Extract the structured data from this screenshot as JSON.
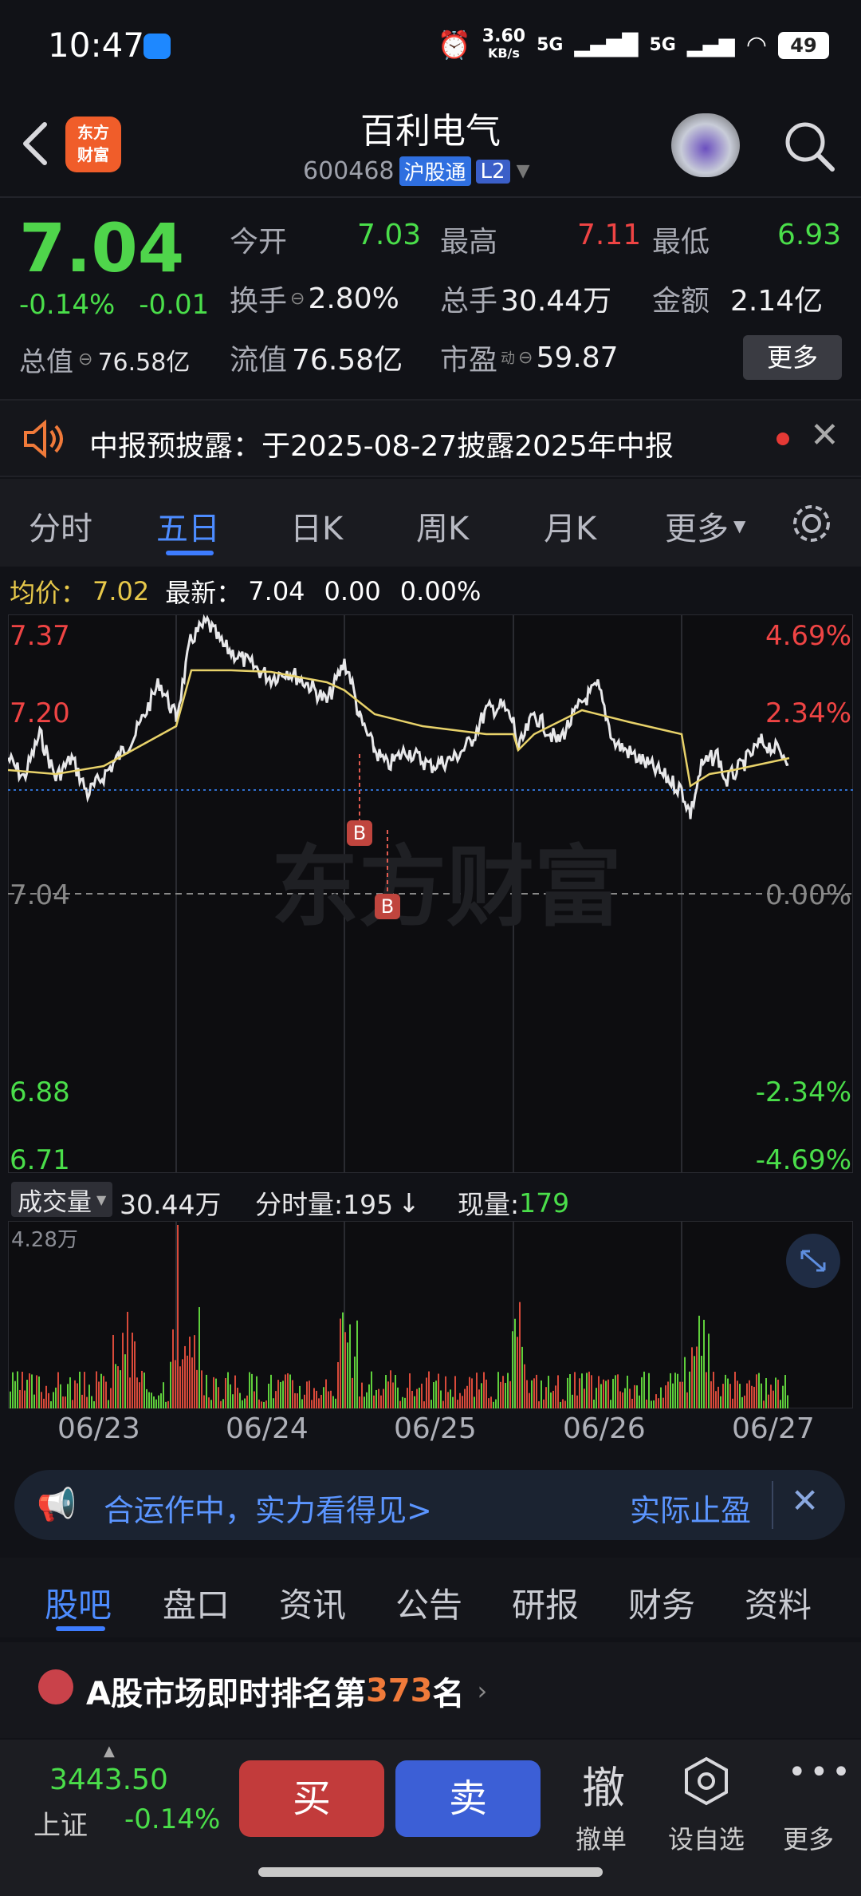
{
  "status_bar": {
    "time": "10:47",
    "net_speed_top": "3.60",
    "net_speed_unit": "KB/s",
    "sig1": "5G",
    "sig2": "5G",
    "battery": "49"
  },
  "header": {
    "title": "百利电气",
    "code": "600468",
    "tag1": "沪股通",
    "tag2": "L2",
    "logo_line1": "东方",
    "logo_line2": "财富"
  },
  "quote": {
    "price": "7.04",
    "change_pct": "-0.14%",
    "change": "-0.01",
    "open_label": "今开",
    "open": "7.03",
    "high_label": "最高",
    "high": "7.11",
    "low_label": "最低",
    "low": "6.93",
    "turnover_label": "换手",
    "turnover": "2.80%",
    "volume_label": "总手",
    "volume": "30.44万",
    "amount_label": "金额",
    "amount": "2.14亿",
    "mktcap_label": "总值",
    "mktcap": "76.58亿",
    "float_label": "流值",
    "float": "76.58亿",
    "pe_label": "市盈",
    "pe_sup": "动",
    "pe": "59.87",
    "more": "更多"
  },
  "notice": {
    "text": "中报预披露：于2025-08-27披露2025年中报"
  },
  "tabs": [
    "分时",
    "五日",
    "日K",
    "周K",
    "月K",
    "更多"
  ],
  "info_row": {
    "avg_label": "均价：",
    "avg": "7.02",
    "latest_label": "最新：",
    "latest": "7.04",
    "chg": "0.00",
    "chg_pct": "0.00%"
  },
  "chart_data": {
    "type": "line",
    "title": "",
    "x": [
      "06/23",
      "06/24",
      "06/25",
      "06/26",
      "06/27"
    ],
    "y_left_ticks": [
      "7.37",
      "7.20",
      "7.04",
      "6.88",
      "6.71"
    ],
    "y_right_ticks": [
      "4.69%",
      "2.34%",
      "0.00%",
      "-2.34%",
      "-4.69%"
    ],
    "ylim": [
      6.71,
      7.37
    ],
    "series": [],
    "markers": [
      "B",
      "B"
    ],
    "watermark": "东方财富"
  },
  "volume": {
    "label": "成交量",
    "total": "30.44万",
    "tick_label": "分时量:195",
    "tick_arrow": "↓",
    "now_label": "现量:",
    "now": "179",
    "max": "4.28万"
  },
  "ad": {
    "text": "合运作中，实力看得见>",
    "right": "实际止盈"
  },
  "bottom_tabs": [
    "股吧",
    "盘口",
    "资讯",
    "公告",
    "研报",
    "财务",
    "资料"
  ],
  "rank": {
    "prefix": "A股市场即时排名第",
    "rank": "373",
    "suffix": "名"
  },
  "index": {
    "value": "3443.50",
    "name": "上证",
    "pct": "-0.14%"
  },
  "actions": {
    "buy": "买",
    "sell": "卖",
    "cancel_icon": "撤",
    "cancel": "撤单",
    "watch": "设自选",
    "more": "更多"
  },
  "colors": {
    "up": "#ef4444",
    "down": "#4ade4a",
    "accent": "#3d7cff"
  }
}
